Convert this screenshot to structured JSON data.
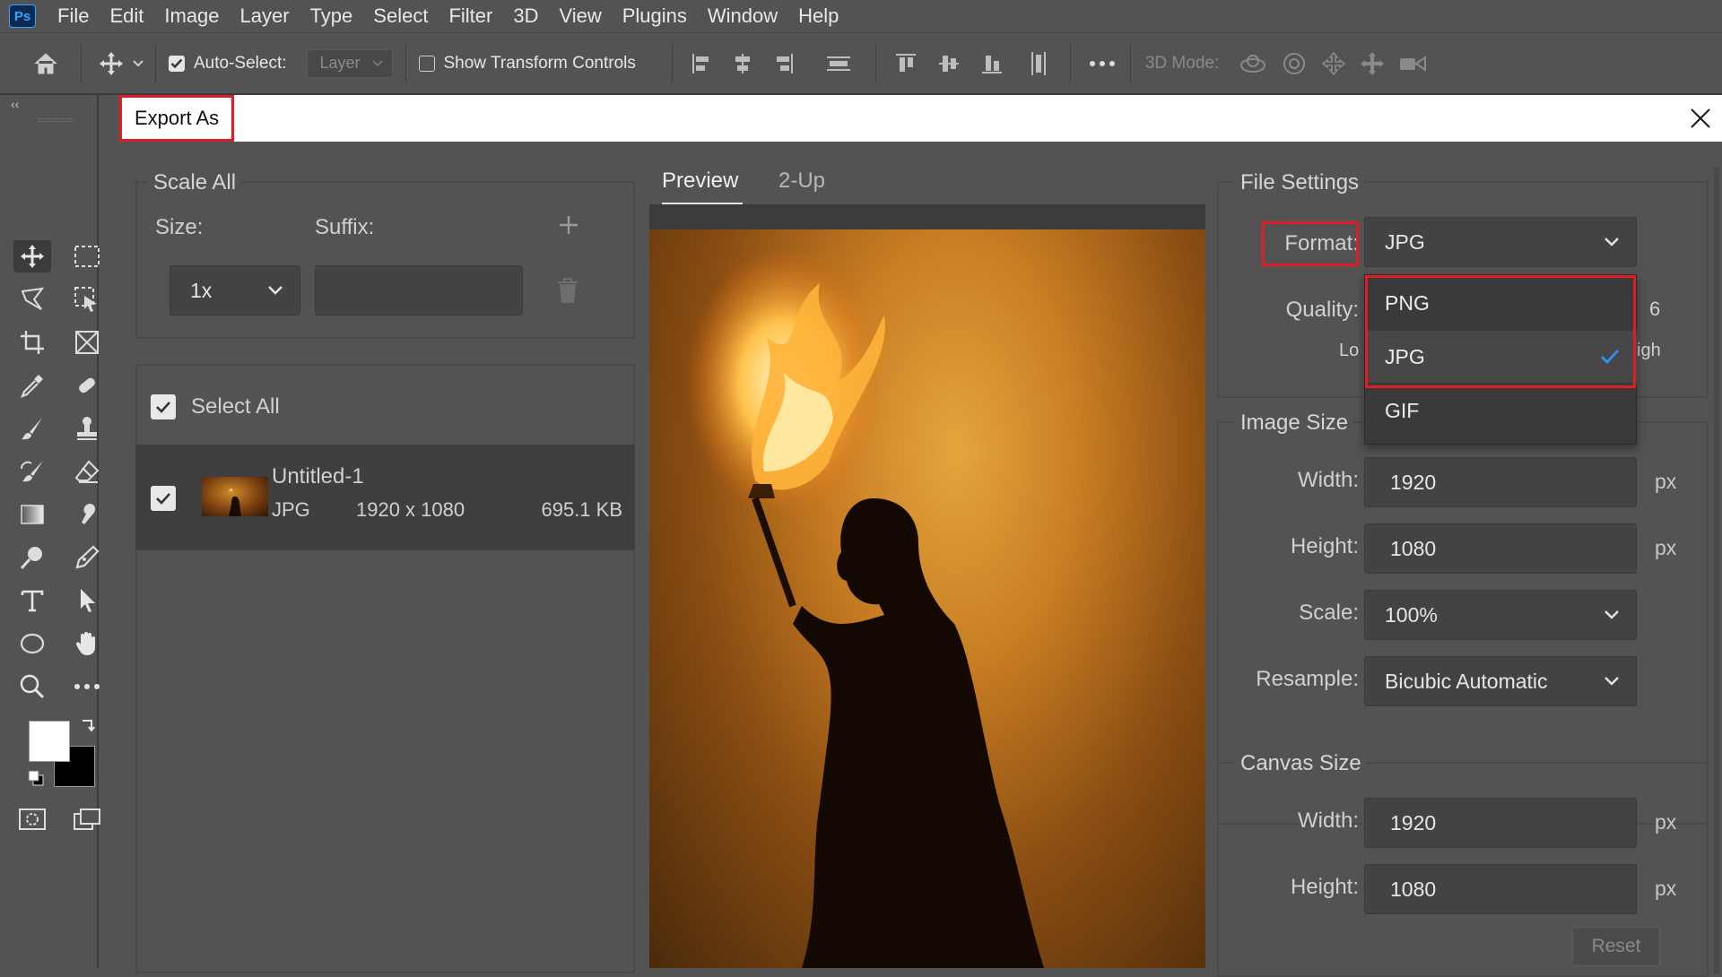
{
  "app": {
    "logo": "Ps",
    "menu": [
      "File",
      "Edit",
      "Image",
      "Layer",
      "Type",
      "Select",
      "Filter",
      "3D",
      "View",
      "Plugins",
      "Window",
      "Help"
    ]
  },
  "options_bar": {
    "auto_select_label": "Auto-Select:",
    "auto_select_checked": true,
    "layer_select_value": "Layer",
    "show_transform_label": "Show Transform Controls",
    "show_transform_checked": false,
    "mode_3d_label": "3D Mode:"
  },
  "toolbar": {
    "collapse_glyph": "‹‹",
    "foreground_color": "#ffffff",
    "background_color": "#000000"
  },
  "dialog": {
    "title": "Export As",
    "scale_all": {
      "title": "Scale All",
      "size_label": "Size:",
      "suffix_label": "Suffix:",
      "size_value": "1x",
      "suffix_value": ""
    },
    "assets": {
      "select_all_label": "Select All",
      "select_all_checked": true,
      "items": [
        {
          "name": "Untitled-1",
          "format": "JPG",
          "dimensions": "1920 x 1080",
          "size": "695.1 KB",
          "checked": true
        }
      ]
    },
    "tabs": [
      "Preview",
      "2-Up"
    ],
    "active_tab": "Preview",
    "file_settings": {
      "title": "File Settings",
      "format_label": "Format:",
      "format_value": "JPG",
      "format_options": [
        "PNG",
        "JPG",
        "GIF"
      ],
      "format_selected": "JPG",
      "quality_label": "Quality:",
      "quality_value_partial": "6",
      "quality_low_partial": "Lo",
      "quality_high_partial": "igh"
    },
    "image_size": {
      "title": "Image Size",
      "width_label": "Width:",
      "width_value": "1920",
      "height_label": "Height:",
      "height_value": "1080",
      "scale_label": "Scale:",
      "scale_value": "100%",
      "resample_label": "Resample:",
      "resample_value": "Bicubic Automatic",
      "unit": "px"
    },
    "canvas_size": {
      "title": "Canvas Size",
      "width_label": "Width:",
      "width_value": "1920",
      "height_label": "Height:",
      "height_value": "1080",
      "unit": "px",
      "reset_label": "Reset"
    },
    "accent_color": "#e01c24",
    "check_color": "#3a8cf0"
  }
}
